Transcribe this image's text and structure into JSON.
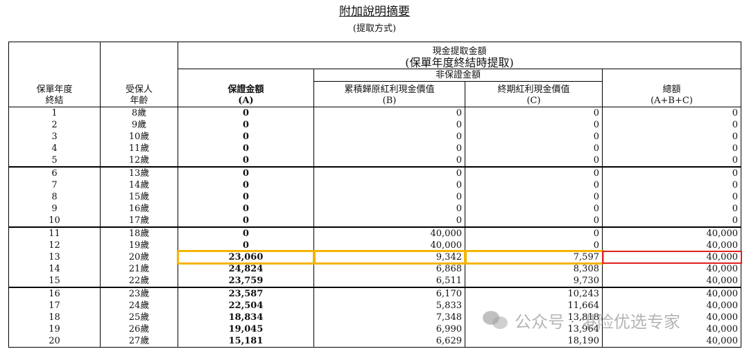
{
  "doc": {
    "title": "附加說明摘要",
    "subtitle": "(提取方式)"
  },
  "header": {
    "cash_withdrawal": "現金提取金額",
    "at_year_end": "(保單年度終結時提取)",
    "non_guaranteed": "非保證金額",
    "col_year": [
      "保單年度",
      "終結"
    ],
    "col_age": [
      "受保人",
      "年齡"
    ],
    "col_a": [
      "保證金額",
      "(A)"
    ],
    "col_b": [
      "累積歸原紅利現金價值",
      "(B)"
    ],
    "col_c": [
      "終期紅利現金價值",
      "(C)"
    ],
    "col_total": [
      "總額",
      "(A+B+C)"
    ]
  },
  "rows": [
    {
      "year": "1",
      "age": "8歲",
      "a": "0",
      "b": "0",
      "c": "0",
      "total": "0"
    },
    {
      "year": "2",
      "age": "9歲",
      "a": "0",
      "b": "0",
      "c": "0",
      "total": "0"
    },
    {
      "year": "3",
      "age": "10歲",
      "a": "0",
      "b": "0",
      "c": "0",
      "total": "0"
    },
    {
      "year": "4",
      "age": "11歲",
      "a": "0",
      "b": "0",
      "c": "0",
      "total": "0"
    },
    {
      "year": "5",
      "age": "12歲",
      "a": "0",
      "b": "0",
      "c": "0",
      "total": "0"
    },
    {
      "year": "6",
      "age": "13歲",
      "a": "0",
      "b": "0",
      "c": "0",
      "total": "0"
    },
    {
      "year": "7",
      "age": "14歲",
      "a": "0",
      "b": "0",
      "c": "0",
      "total": "0"
    },
    {
      "year": "8",
      "age": "15歲",
      "a": "0",
      "b": "0",
      "c": "0",
      "total": "0"
    },
    {
      "year": "9",
      "age": "16歲",
      "a": "0",
      "b": "0",
      "c": "0",
      "total": "0"
    },
    {
      "year": "10",
      "age": "17歲",
      "a": "0",
      "b": "0",
      "c": "0",
      "total": "0"
    },
    {
      "year": "11",
      "age": "18歲",
      "a": "0",
      "b": "40,000",
      "c": "0",
      "total": "40,000"
    },
    {
      "year": "12",
      "age": "19歲",
      "a": "0",
      "b": "40,000",
      "c": "0",
      "total": "40,000"
    },
    {
      "year": "13",
      "age": "20歲",
      "a": "23,060",
      "b": "9,342",
      "c": "7,597",
      "total": "40,000"
    },
    {
      "year": "14",
      "age": "21歲",
      "a": "24,824",
      "b": "6,868",
      "c": "8,308",
      "total": "40,000"
    },
    {
      "year": "15",
      "age": "22歲",
      "a": "23,759",
      "b": "6,511",
      "c": "9,730",
      "total": "40,000"
    },
    {
      "year": "16",
      "age": "23歲",
      "a": "23,587",
      "b": "6,170",
      "c": "10,243",
      "total": "40,000"
    },
    {
      "year": "17",
      "age": "24歲",
      "a": "22,504",
      "b": "5,833",
      "c": "11,664",
      "total": "40,000"
    },
    {
      "year": "18",
      "age": "25歲",
      "a": "18,834",
      "b": "7,348",
      "c": "13,818",
      "total": "40,000"
    },
    {
      "year": "19",
      "age": "26歲",
      "a": "19,045",
      "b": "6,990",
      "c": "13,964",
      "total": "40,000"
    },
    {
      "year": "20",
      "age": "27歲",
      "a": "15,181",
      "b": "6,629",
      "c": "18,190",
      "total": "40,000"
    }
  ],
  "highlights": {
    "year_13_yellow": "#f5b400",
    "year_13_total_red": "#e02020"
  },
  "watermark": {
    "icon": "wechat-icon",
    "text": "公众号 · 港险优选专家"
  }
}
